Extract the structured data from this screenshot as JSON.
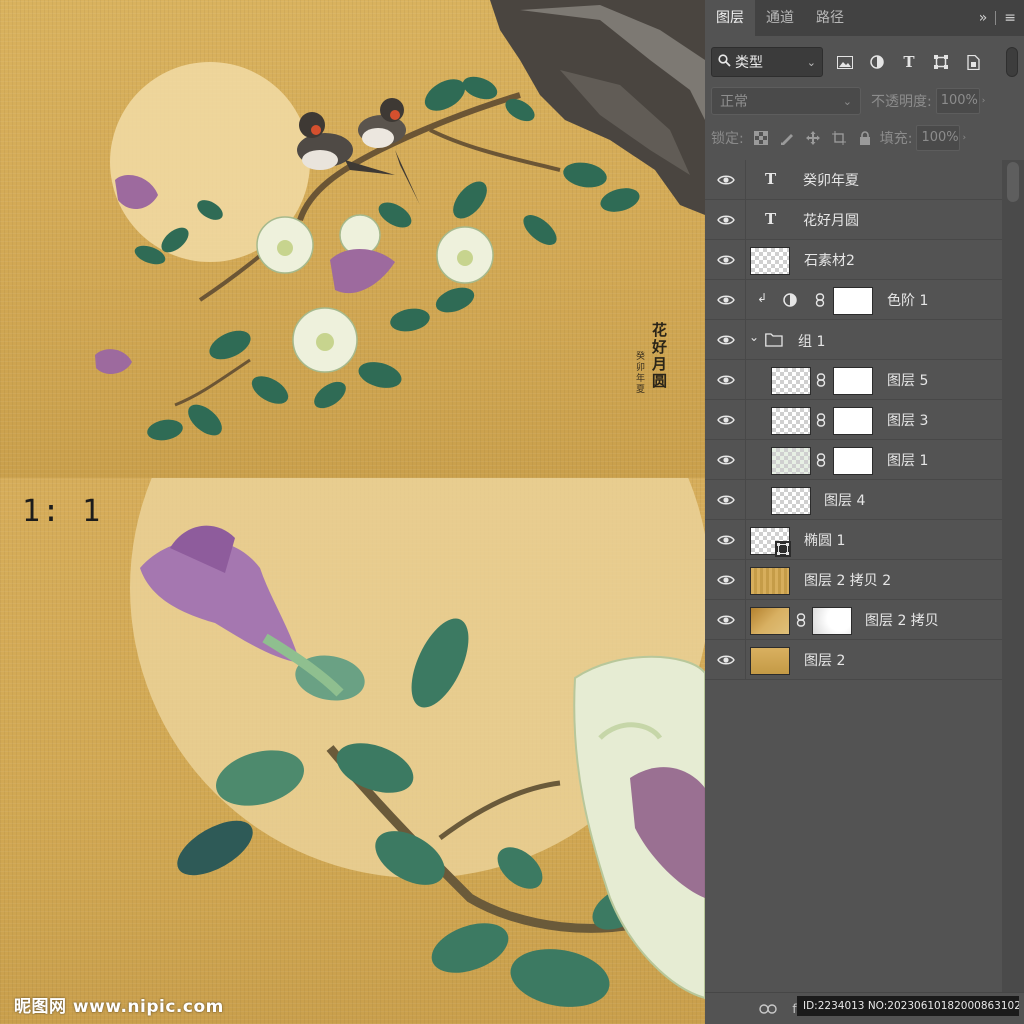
{
  "artwork": {
    "ratio_label": "1: 1",
    "poem_title": "花好月圆",
    "signature": "癸卯年夏",
    "watermark": "昵图网 www.nipic.com"
  },
  "panel": {
    "tabs": [
      {
        "label": "图层",
        "active": true
      },
      {
        "label": "通道",
        "active": false
      },
      {
        "label": "路径",
        "active": false
      }
    ],
    "filter": {
      "kind_label": "类型",
      "icons": [
        "image-filter-icon",
        "adjustment-filter-icon",
        "type-filter-icon",
        "shape-filter-icon",
        "smart-object-filter-icon"
      ]
    },
    "blend_mode": "正常",
    "opacity_label": "不透明度:",
    "opacity_value": "100%",
    "lock_label": "锁定:",
    "fill_label": "填充:",
    "fill_value": "100%",
    "layers": [
      {
        "name": "癸卯年夏",
        "kind": "text"
      },
      {
        "name": "花好月圆",
        "kind": "text"
      },
      {
        "name": "石素材2",
        "kind": "pixel"
      },
      {
        "name": "色阶 1",
        "kind": "adjustment"
      },
      {
        "name": "组 1",
        "kind": "group"
      },
      {
        "name": "图层 5",
        "kind": "masked"
      },
      {
        "name": "图层 3",
        "kind": "masked"
      },
      {
        "name": "图层 1",
        "kind": "masked"
      },
      {
        "name": "图层 4",
        "kind": "pixel"
      },
      {
        "name": "椭圆 1",
        "kind": "shape"
      },
      {
        "name": "图层 2 拷贝 2",
        "kind": "pixel"
      },
      {
        "name": "图层 2 拷贝",
        "kind": "masked"
      },
      {
        "name": "图层 2",
        "kind": "pixel"
      }
    ],
    "image_id": "ID:2234013 NO:20230610182000863102"
  },
  "colors": {
    "panel_bg": "#535353",
    "tab_bar": "#424242",
    "canvas_gold": "#d4ab57",
    "moon": "#f0d9a0"
  }
}
